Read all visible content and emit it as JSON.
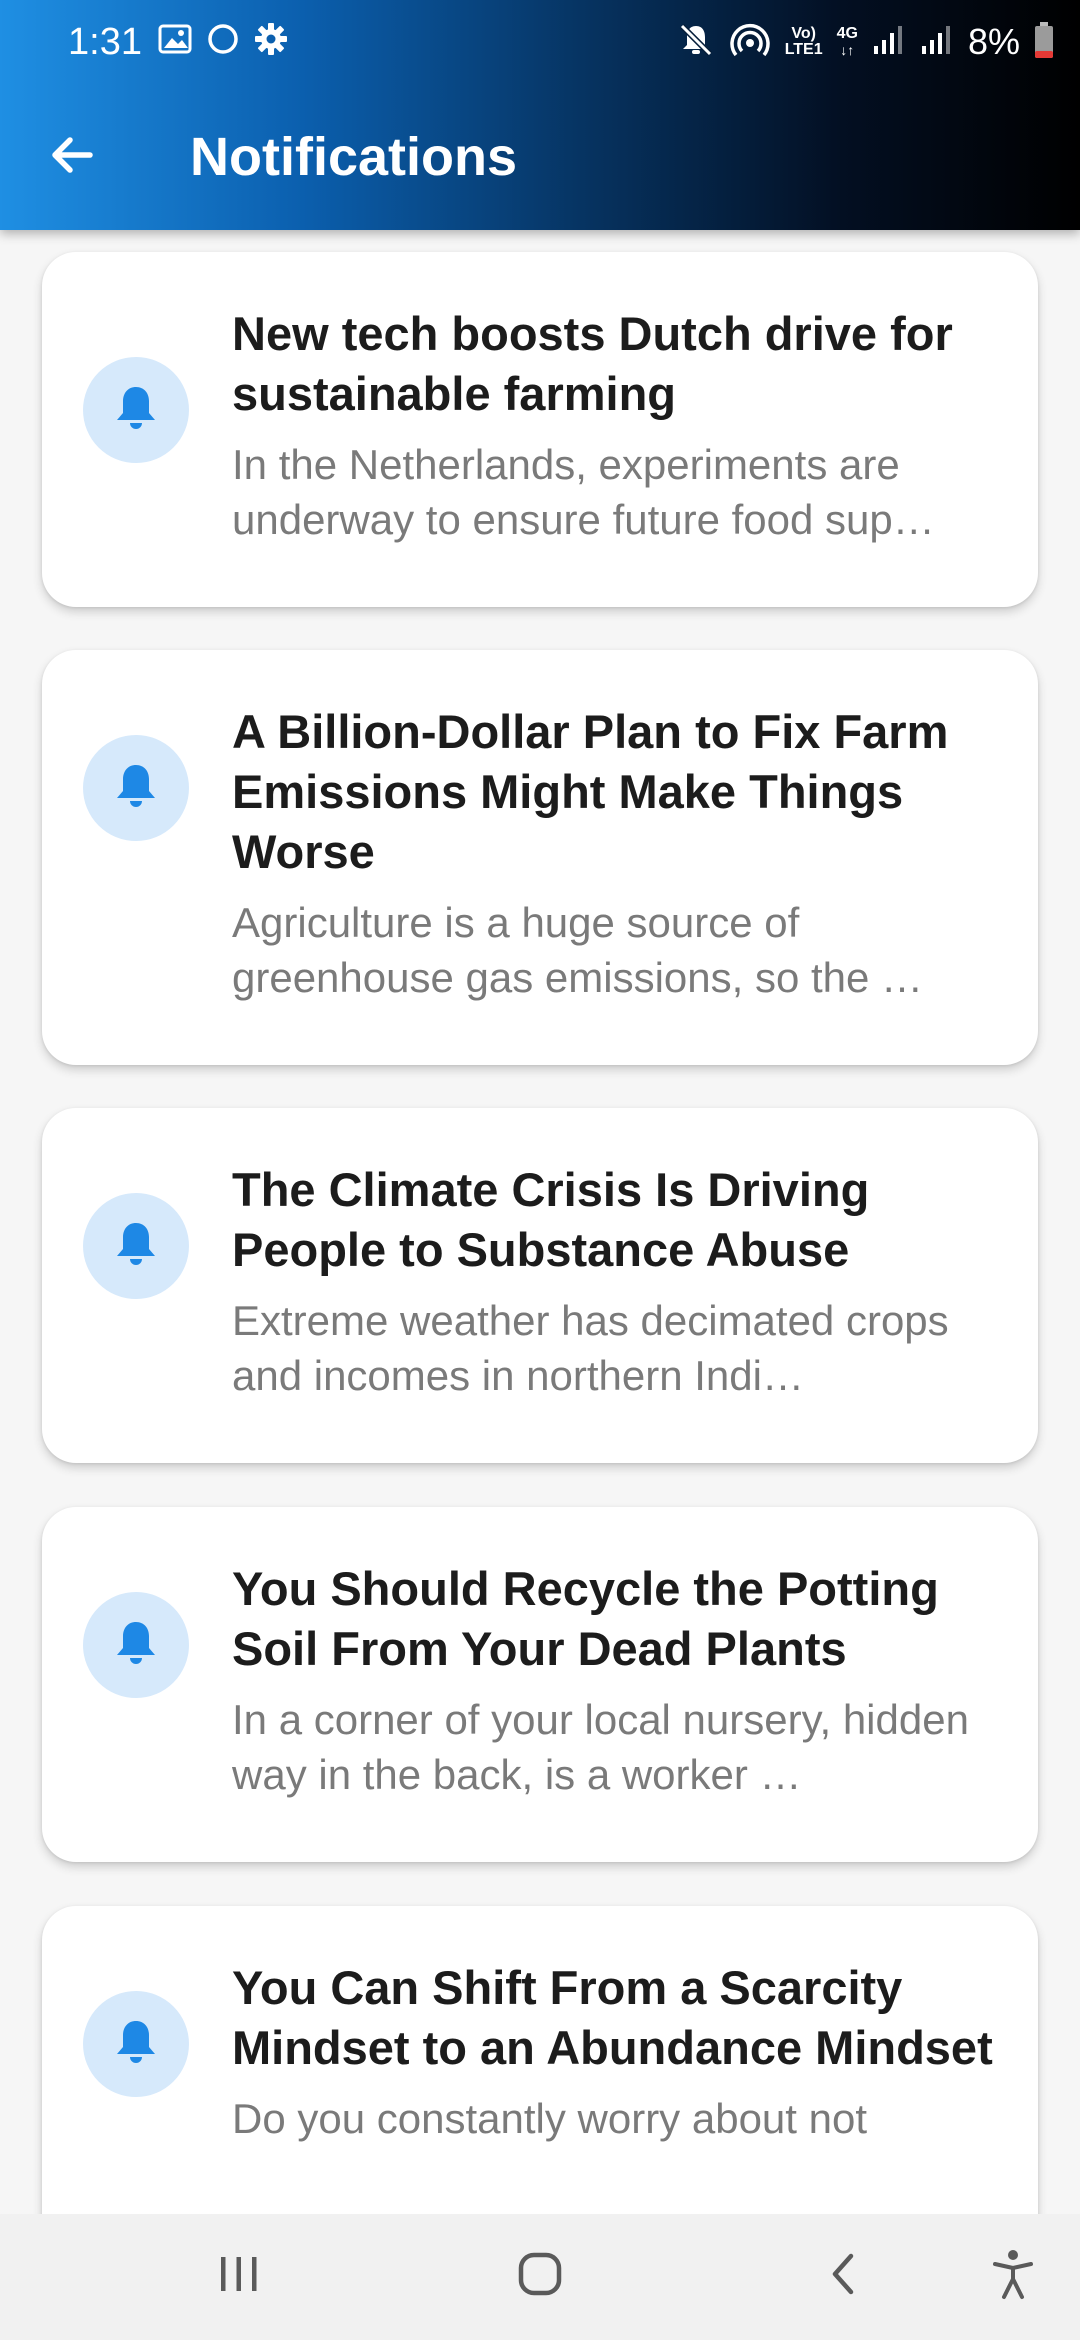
{
  "status_bar": {
    "time": "1:31",
    "battery": "8%",
    "network_label_top": "Vo)",
    "network_label_bottom": "LTE1",
    "network_type": "4G",
    "icons": [
      "gallery-icon",
      "circle-icon",
      "settings-gear-icon",
      "mute-icon",
      "hotspot-icon",
      "volte-icon",
      "data-4g-icon",
      "signal-icon",
      "signal-icon",
      "battery-icon"
    ]
  },
  "appbar": {
    "title": "Notifications",
    "back_icon": "arrow-left-icon"
  },
  "colors": {
    "accent": "#1E88E5",
    "icon_bg": "#D6E9FB",
    "title_text": "#1C1C1C",
    "body_text": "#7A7A7A",
    "page_bg": "#F6F6F6"
  },
  "notifications": [
    {
      "title": "New tech boosts Dutch drive for sustainable farming",
      "body": "In the Netherlands, experiments are underway to ensure future food sup…",
      "icon": "bell-icon"
    },
    {
      "title": "A Billion-Dollar Plan to Fix Farm Emissions Might Make Things Worse",
      "body": "Agriculture is a huge source of greenhouse gas emissions, so the …",
      "icon": "bell-icon"
    },
    {
      "title": "The Climate Crisis Is Driving People to Substance Abuse",
      "body": "Extreme weather has decimated crops and incomes in northern Indi…",
      "icon": "bell-icon"
    },
    {
      "title": "You Should Recycle the Potting Soil From Your Dead Plants",
      "body": "In a corner of your local nursery, hidden way in the back, is a worker …",
      "icon": "bell-icon"
    },
    {
      "title": "You Can Shift From a Scarcity Mindset to an Abundance Mindset",
      "body": "Do you constantly worry about not",
      "icon": "bell-icon"
    }
  ],
  "nav_bar": {
    "buttons": [
      "recent-apps-icon",
      "home-icon",
      "back-icon",
      "accessibility-icon"
    ]
  }
}
